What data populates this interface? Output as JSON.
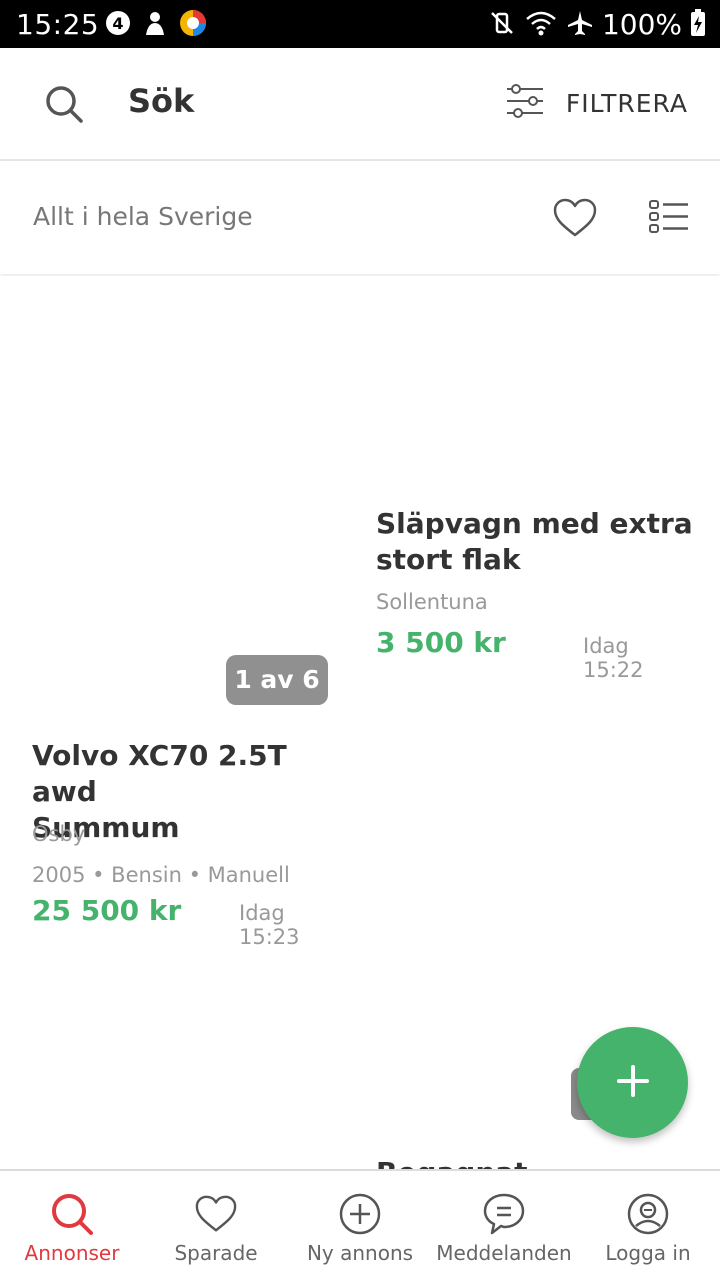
{
  "status_bar": {
    "time": "15:25",
    "battery": "100%"
  },
  "header": {
    "title": "Sök",
    "filter_label": "FILTRERA"
  },
  "region_bar": {
    "region": "Allt i hela Sverige"
  },
  "listings": [
    {
      "title_line1": "Volvo XC70 2.5T awd",
      "title_line2": "Summum",
      "location": "Osby",
      "meta": "2005 • Bensin • Manuell",
      "price": "25 500 kr",
      "time": "Idag 15:23",
      "image_counter": "1 av 6"
    },
    {
      "title_line1": "Släpvagn med extra",
      "title_line2": "stort flak",
      "location": "Sollentuna",
      "price": "3 500 kr",
      "time": "Idag 15:22"
    },
    {
      "title_line1": "Begagnat"
    }
  ],
  "bottom_nav": {
    "items": [
      {
        "label": "Annonser",
        "icon": "search-icon",
        "active": true
      },
      {
        "label": "Sparade",
        "icon": "heart-icon"
      },
      {
        "label": "Ny annons",
        "icon": "plus-circle-icon"
      },
      {
        "label": "Meddelanden",
        "icon": "chat-icon"
      },
      {
        "label": "Logga in",
        "icon": "user-icon"
      }
    ]
  },
  "colors": {
    "accent_green": "#45b36b",
    "active_red": "#e0393e",
    "text_dark": "#333333",
    "text_grey": "#999999"
  }
}
